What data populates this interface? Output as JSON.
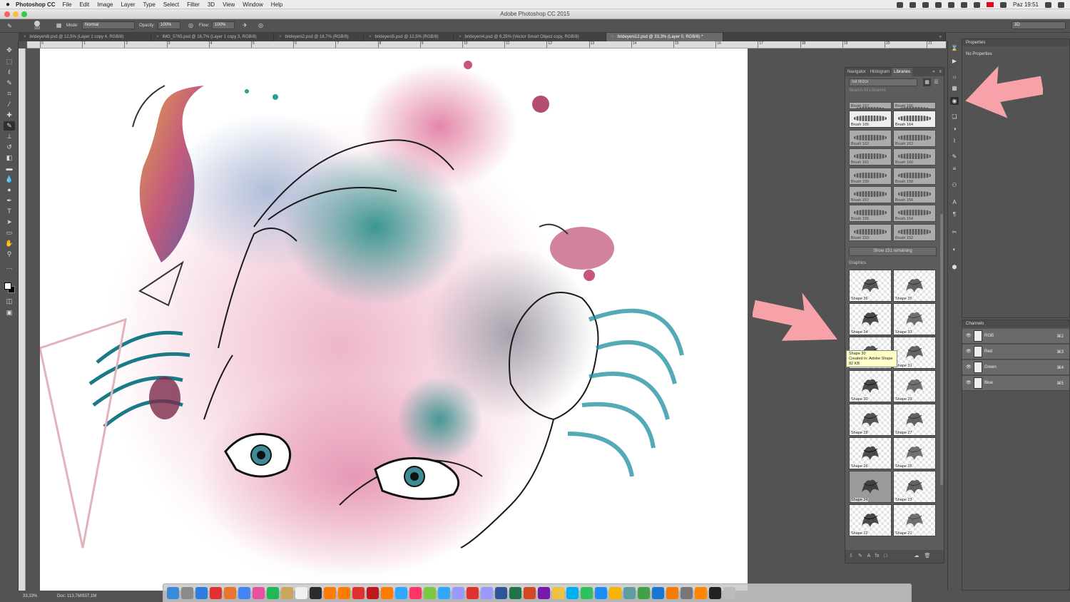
{
  "menubar": {
    "app_name": "Photoshop CC",
    "items": [
      "File",
      "Edit",
      "Image",
      "Layer",
      "Type",
      "Select",
      "Filter",
      "3D",
      "View",
      "Window",
      "Help"
    ],
    "clock": "Paz 19:51"
  },
  "window": {
    "title": "Adobe Photoshop CC 2015"
  },
  "options": {
    "brush_size": "152",
    "mode_label": "Mode:",
    "mode_value": "Normal",
    "opacity_label": "Opacity:",
    "opacity_value": "100%",
    "flow_label": "Flow:",
    "flow_value": "100%",
    "workspace": "3D"
  },
  "tabs": [
    {
      "label": "brideyeni8.psd @ 12,5% (Layer 1 copy 4, RGB/8)",
      "active": false
    },
    {
      "label": "IMG_5765.psd @ 16,7% (Layer 1 copy 3, RGB/8)",
      "active": false
    },
    {
      "label": "brideyeni2.psd @ 16,7% (RGB/8)",
      "active": false
    },
    {
      "label": "brideyeni5.psd @ 12,5% (RGB/8)",
      "active": false
    },
    {
      "label": "brideyeni4.psd @ 6,25% (Vector Smart Object copy, RGB/8)",
      "active": false
    },
    {
      "label": "brideyeni12.psd @ 33,3% (Layer 0, RGB/8) *",
      "active": true
    }
  ],
  "ruler_h_ticks": [
    "0",
    "1",
    "2",
    "3",
    "4",
    "5",
    "6",
    "7",
    "8",
    "9",
    "10",
    "11",
    "12",
    "13",
    "14",
    "15",
    "16",
    "17",
    "18",
    "19",
    "20",
    "21"
  ],
  "status": {
    "zoom": "33,33%",
    "doc": "Doc: 113,7M/937,1M"
  },
  "libraries": {
    "tabs": [
      "Navigator",
      "Histogram",
      "Libraries"
    ],
    "library_name": "Isil Ilrizoi",
    "search_placeholder": "Search All Libraries",
    "brushes": [
      "Brush 167",
      "Brush 166",
      "Brush 165",
      "Brush 164",
      "Brush 163",
      "Brush 162",
      "Brush 161",
      "Brush 160",
      "Brush 159",
      "Brush 158",
      "Brush 157",
      "Brush 156",
      "Brush 155",
      "Brush 154",
      "Brush 153",
      "Brush 152"
    ],
    "show_remaining": "Show 151 remaining",
    "graphics_heading": "Graphics",
    "graphics": [
      "Shape 36",
      "Shape 35",
      "Shape 34",
      "Shape 33",
      "Shape 32",
      "Shape 31",
      "Shape 30",
      "Shape 29",
      "Shape 28",
      "Shape 27",
      "Shape 26",
      "Shape 25",
      "Shape 24",
      "Shape 23",
      "Shape 22",
      "Shape 21"
    ],
    "tooltip": {
      "name": "Shape 30",
      "source": "Created in: Adobe Shape",
      "size": "82 KB"
    }
  },
  "properties": {
    "title": "Properties",
    "empty": "No Properties"
  },
  "channels": {
    "title": "Channels",
    "items": [
      {
        "name": "RGB",
        "shortcut": "⌘2"
      },
      {
        "name": "Red",
        "shortcut": "⌘3"
      },
      {
        "name": "Green",
        "shortcut": "⌘4"
      },
      {
        "name": "Blue",
        "shortcut": "⌘5"
      }
    ]
  },
  "dock_apps": [
    "Finder",
    "Launchpad",
    "Safari",
    "Yandex",
    "Firefox",
    "Chrome",
    "iTunes",
    "Spotify",
    "Notes",
    "Calendar",
    "Fs",
    "Ai",
    "Ai",
    "Creative Cloud",
    "Acrobat",
    "Ai",
    "Ps",
    "Id",
    "Mu",
    "Lr",
    "Ae",
    "Fl",
    "Pr",
    "Word",
    "Excel",
    "PowerPoint",
    "OneNote",
    "Photos",
    "Skype",
    "FaceTime",
    "App Store",
    "Sketch",
    "Preview",
    "Numbers",
    "Keynote",
    "Pages",
    "System Preferences",
    "VLC",
    "Terminal",
    "Trash"
  ],
  "colors": {
    "accent_arrow": "#f7a1a8",
    "panel_bg": "#535353",
    "canvas": "#ffffff"
  }
}
